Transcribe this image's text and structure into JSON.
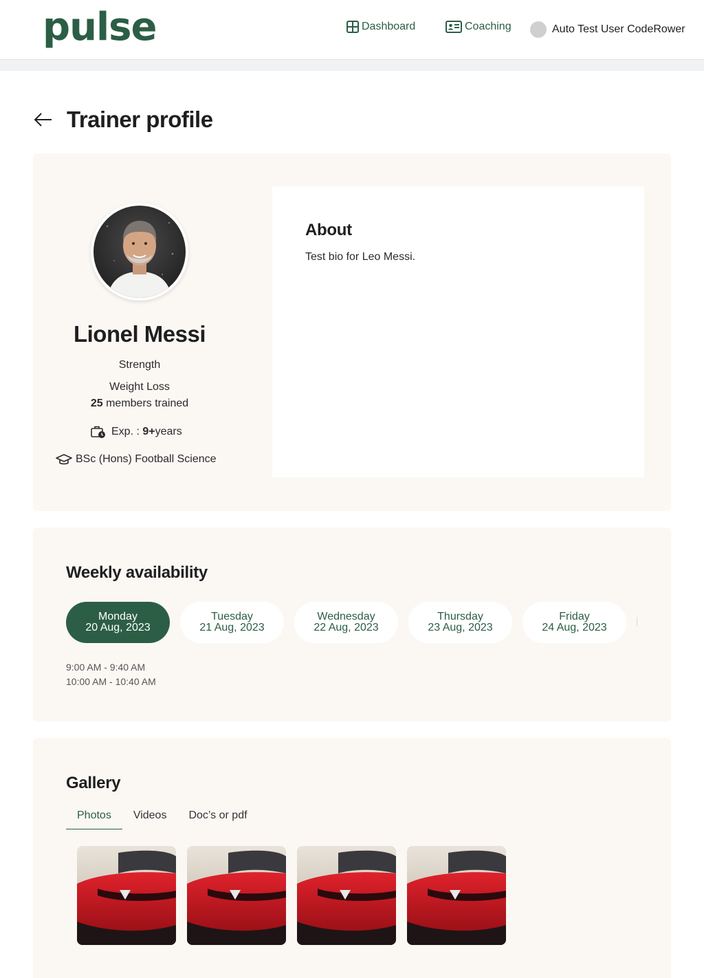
{
  "header": {
    "logo": "pulse",
    "nav": {
      "dashboard": "Dashboard",
      "coaching": "Coaching"
    },
    "user_name": "Auto Test User CodeRower"
  },
  "page": {
    "title": "Trainer profile"
  },
  "profile": {
    "name": "Lionel Messi",
    "specialities": [
      "Strength",
      "Weight Loss"
    ],
    "members_count": "25",
    "members_text": " members trained",
    "exp_label": "Exp. : ",
    "exp_value": "9+",
    "exp_unit": " years",
    "education": "BSc (Hons) Football Science"
  },
  "about": {
    "title": "About",
    "bio": "Test bio for Leo Messi."
  },
  "availability": {
    "title": "Weekly availability",
    "days": [
      {
        "day": "Monday",
        "date": "20 Aug, 2023",
        "active": true
      },
      {
        "day": "Tuesday",
        "date": "21 Aug, 2023",
        "active": false
      },
      {
        "day": "Wednesday",
        "date": "22 Aug, 2023",
        "active": false
      },
      {
        "day": "Thursday",
        "date": "23 Aug, 2023",
        "active": false
      },
      {
        "day": "Friday",
        "date": "24 Aug, 2023",
        "active": false
      }
    ],
    "slots": [
      "9:00 AM - 9:40 AM",
      "10:00 AM - 10:40 AM"
    ]
  },
  "gallery": {
    "title": "Gallery",
    "tabs": [
      "Photos",
      "Videos",
      "Doc’s or pdf"
    ],
    "active_tab": "Photos",
    "photo_count": 4
  },
  "colors": {
    "brand": "#2c5e45",
    "card_bg": "#fbf8f4"
  }
}
